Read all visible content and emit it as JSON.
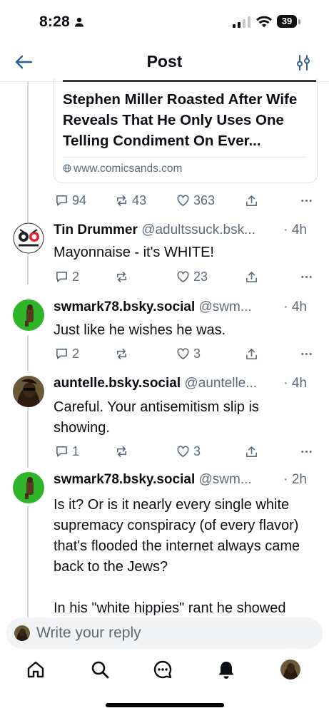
{
  "status_bar": {
    "time": "8:28",
    "battery": "39"
  },
  "header": {
    "title": "Post"
  },
  "link_card": {
    "title": "Stephen Miller Roasted After Wife Reveals That He Only Uses One Telling Condiment On Ever...",
    "domain": "www.comicsands.com"
  },
  "main_post_actions": {
    "replies": "94",
    "reposts": "43",
    "likes": "363"
  },
  "replies": [
    {
      "display_name": "Tin Drummer",
      "handle": "@adultssuck.bsk...",
      "time": "· 4h",
      "text": "Mayonnaise - it's WHITE!",
      "replies": "2",
      "likes": "23"
    },
    {
      "display_name": "swmark78.bsky.social",
      "handle": "@swm...",
      "time": "· 4h",
      "text": "Just like he wishes he was.",
      "replies": "2",
      "likes": "3"
    },
    {
      "display_name": "auntelle.bsky.social",
      "handle": "@auntelle...",
      "time": "· 4h",
      "text": "Careful. Your antisemitism slip is showing.",
      "replies": "1",
      "likes": "3"
    },
    {
      "display_name": "swmark78.bsky.social",
      "handle": "@swm...",
      "time": "· 2h",
      "text": "Is it? Or is it nearly every single white supremacy conspiracy (of every flavor) that's flooded the internet always came back to the Jews?",
      "text2": "In his \"white hippies\" rant he showed"
    }
  ],
  "composer": {
    "placeholder": "Write your reply"
  },
  "icons": [
    "back-arrow-icon",
    "filter-icon",
    "reply-icon",
    "repost-icon",
    "like-icon",
    "share-icon",
    "more-icon",
    "home-icon",
    "search-icon",
    "chat-icon",
    "notifications-icon"
  ]
}
